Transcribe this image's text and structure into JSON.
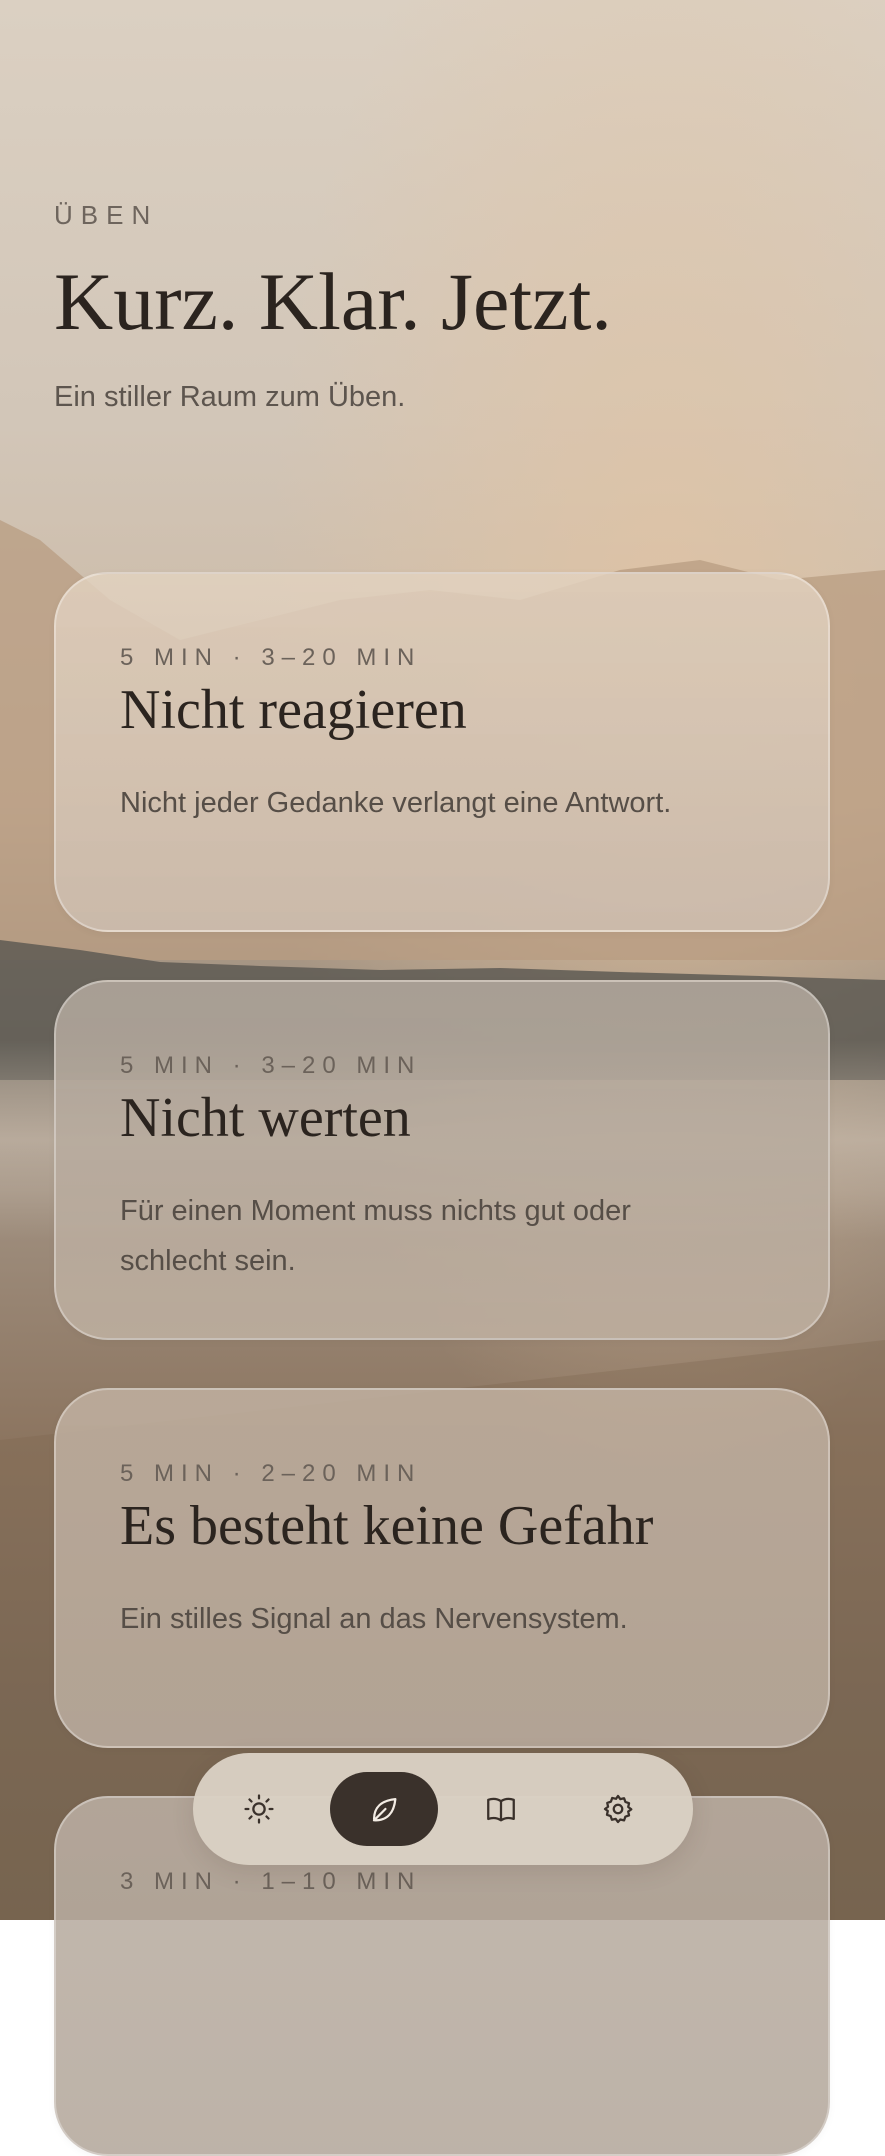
{
  "header": {
    "eyebrow": "ÜBEN",
    "title": "Kurz. Klar. Jetzt.",
    "subtitle": "Ein stiller Raum zum Üben."
  },
  "cards": [
    {
      "meta": "5 MIN · 3–20 MIN",
      "title": "Nicht reagieren",
      "description": "Nicht jeder Gedanke verlangt eine Antwort."
    },
    {
      "meta": "5 MIN · 3–20 MIN",
      "title": "Nicht werten",
      "description": "Für einen Moment muss nichts gut oder schlecht sein."
    },
    {
      "meta": "5 MIN · 2–20 MIN",
      "title": "Es besteht keine Gefahr",
      "description": "Ein stilles Signal an das Nervensystem."
    },
    {
      "meta": "3 MIN · 1–10 MIN",
      "title": "",
      "description": ""
    }
  ],
  "nav": {
    "items": [
      {
        "icon": "sun-icon",
        "active": false
      },
      {
        "icon": "leaf-icon",
        "active": true
      },
      {
        "icon": "book-icon",
        "active": false
      },
      {
        "icon": "gear-icon",
        "active": false
      }
    ]
  },
  "colors": {
    "text_primary": "#2b241f",
    "text_secondary": "#5d554e",
    "nav_active": "#3a312b",
    "nav_bar": "#dad0c4"
  }
}
